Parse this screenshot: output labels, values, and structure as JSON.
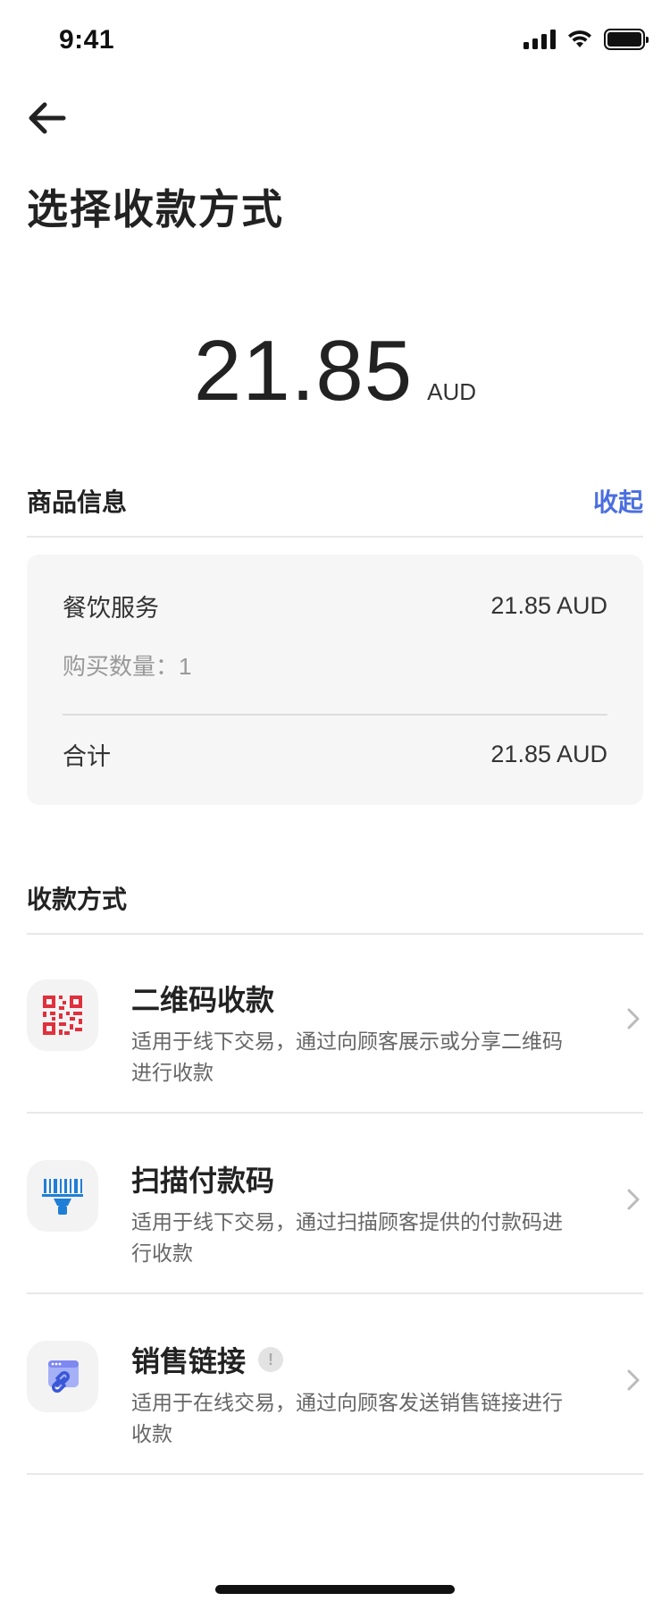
{
  "status_bar": {
    "time": "9:41"
  },
  "page": {
    "title": "选择收款方式"
  },
  "amount": {
    "value": "21.85",
    "currency": "AUD"
  },
  "product_section": {
    "title": "商品信息",
    "collapse_label": "收起",
    "item_name": "餐饮服务",
    "item_price": "21.85 AUD",
    "quantity_label": "购买数量：1",
    "total_label": "合计",
    "total_value": "21.85 AUD"
  },
  "methods_section": {
    "title": "收款方式",
    "methods": [
      {
        "title": "二维码收款",
        "description": "适用于线下交易，通过向顾客展示或分享二维码进行收款",
        "icon": "qr-code-icon"
      },
      {
        "title": "扫描付款码",
        "description": "适用于线下交易，通过扫描顾客提供的付款码进行收款",
        "icon": "barcode-scanner-icon"
      },
      {
        "title": "销售链接",
        "description": "适用于在线交易，通过向顾客发送销售链接进行收款",
        "icon": "sales-link-icon",
        "badge": "!"
      }
    ]
  },
  "colors": {
    "accent": "#4a6ee0",
    "qr_red": "#e0303d",
    "scanner_blue": "#1f7fd6",
    "link_purple": "#7e88f0"
  }
}
